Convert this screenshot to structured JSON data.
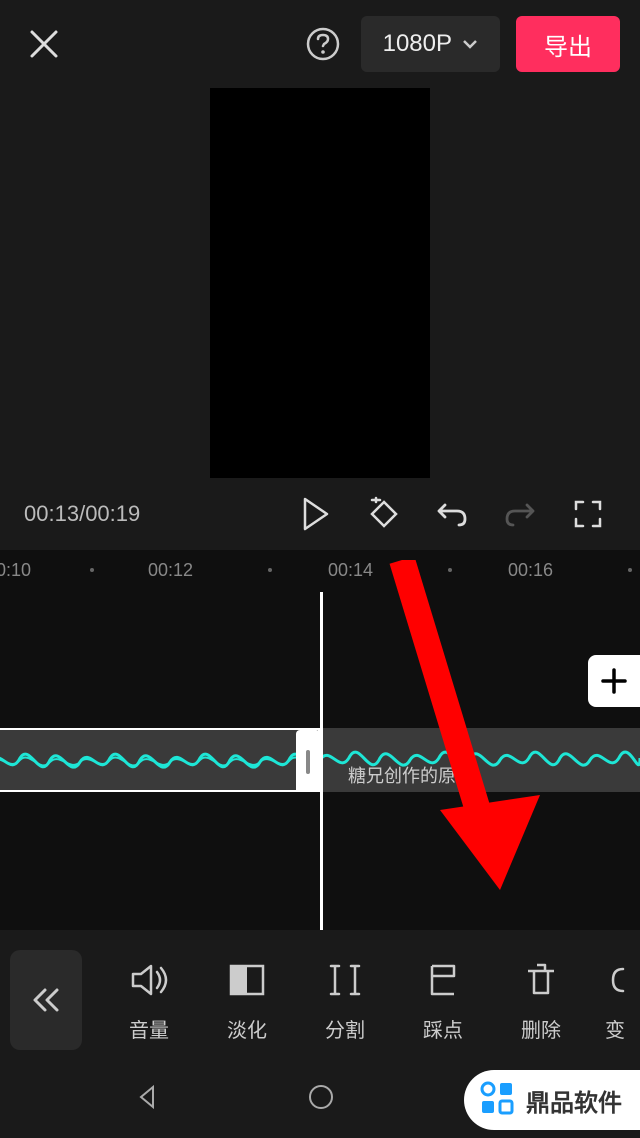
{
  "header": {
    "resolution": "1080P",
    "export_label": "导出"
  },
  "playback": {
    "current_time": "00:13",
    "total_time": "00:19"
  },
  "timeline": {
    "ruler": [
      "0:10",
      "00:12",
      "00:14",
      "00:16"
    ],
    "clip_label": "糖兄创作的原声"
  },
  "toolbar": {
    "items": [
      {
        "label": "音量",
        "icon": "volume-icon"
      },
      {
        "label": "淡化",
        "icon": "fade-icon"
      },
      {
        "label": "分割",
        "icon": "split-icon"
      },
      {
        "label": "踩点",
        "icon": "beat-icon"
      },
      {
        "label": "删除",
        "icon": "delete-icon"
      },
      {
        "label": "变",
        "icon": "transform-icon"
      }
    ]
  },
  "watermark": {
    "text": "鼎品软件"
  }
}
